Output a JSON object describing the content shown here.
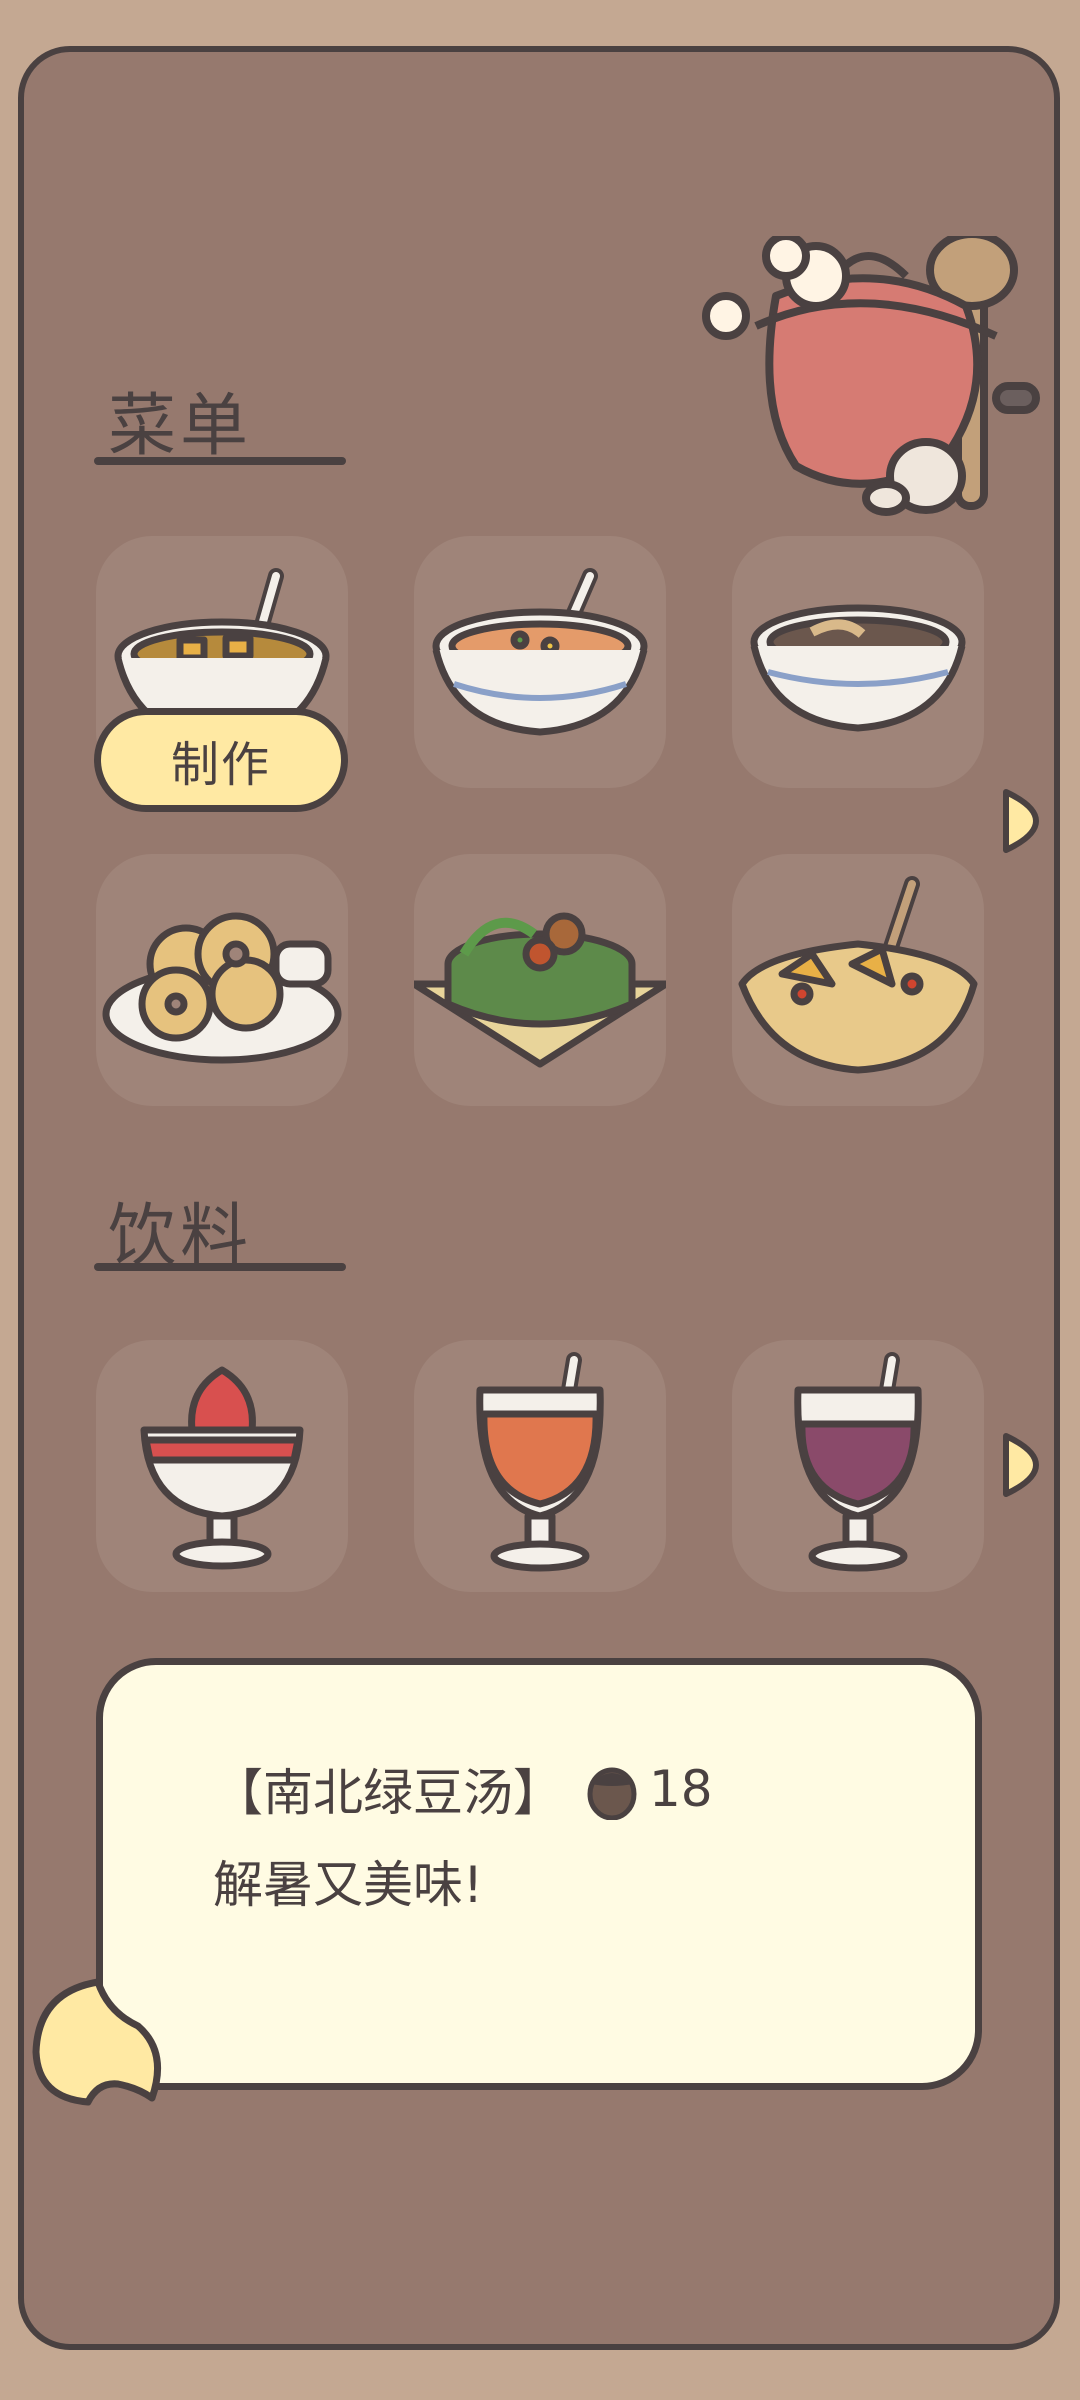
{
  "menu": {
    "title": "菜单",
    "items": [
      {
        "name": "tofu-soup-bowl-icon"
      },
      {
        "name": "mixed-veg-soup-bowl-icon"
      },
      {
        "name": "mung-bean-soup-bowl-icon"
      },
      {
        "name": "donut-plate-icon"
      },
      {
        "name": "vegetable-pot-icon"
      },
      {
        "name": "stir-fry-basket-icon"
      }
    ],
    "make_button": "制作"
  },
  "drinks": {
    "title": "饮料",
    "items": [
      {
        "name": "strawberry-sundae-icon"
      },
      {
        "name": "orange-juice-glass-icon"
      },
      {
        "name": "berry-juice-glass-icon"
      }
    ]
  },
  "description": {
    "item_name": "【南北绿豆汤】",
    "price": "18",
    "currency_icon": "acorn-icon",
    "text": "解暑又美味!"
  },
  "colors": {
    "panel_bg": "#96796e",
    "outline": "#4a4141",
    "accent_yellow": "#ffe9a3",
    "desc_bg": "#fffbe3"
  }
}
